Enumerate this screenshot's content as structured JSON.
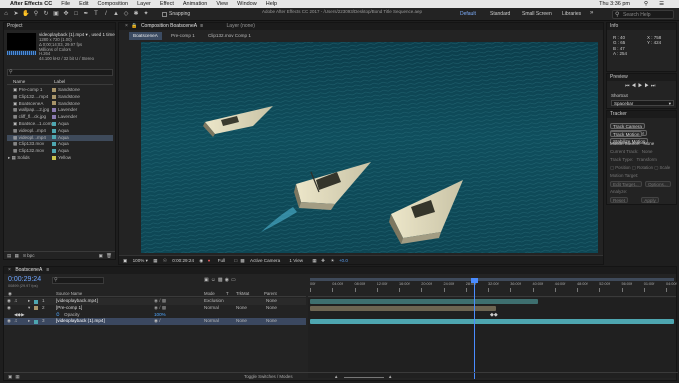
{
  "menubar": {
    "apple": "",
    "app_name": "After Effects CC",
    "menus": [
      "File",
      "Edit",
      "Composition",
      "Layer",
      "Effect",
      "Animation",
      "View",
      "Window",
      "Help"
    ],
    "clock": "Thu 3:36 pm"
  },
  "titlebar": {
    "title": "Adobe After Effects CC 2017 - /Users/223093/Desktop/Bond Title Sequence.aep"
  },
  "toolbar": {
    "snapping_label": "Snapping",
    "workspaces": [
      "Default",
      "Standard",
      "Small Screen",
      "Libraries"
    ],
    "search_placeholder": "Search Help"
  },
  "project": {
    "tab_label": "Project",
    "selected_name": "videoplayback (1).mp4 ▾ , used 1 time",
    "selected_info": [
      "1280 x 720 (1.00)",
      "Δ 0;00;14;03, 29.97 fps",
      "Millions of Colors",
      "H.264",
      "44.100 kHz / 32 bit U / Stereo"
    ],
    "search_placeholder": "",
    "col_name": "Name",
    "col_label": "Label",
    "items": [
      {
        "name": "Pre-comp 1",
        "label": "Sandstone",
        "color": "#a8956a"
      },
      {
        "name": "Clip132....mp4",
        "label": "Sandstone",
        "color": "#a8956a"
      },
      {
        "name": "BoatsceneA",
        "label": "Sandstone",
        "color": "#a8956a"
      },
      {
        "name": "wallpap....2.jpg",
        "label": "Lavender",
        "color": "#8a7ab0"
      },
      {
        "name": "cliff_fl...ck.jpg",
        "label": "Lavender",
        "color": "#8a7ab0"
      },
      {
        "name": "Boatsce...1.comp",
        "label": "Aqua",
        "color": "#4ea6b0"
      },
      {
        "name": "videopl...mp4",
        "label": "Aqua",
        "color": "#4ea6b0"
      },
      {
        "name": "videopl...mp4",
        "label": "Aqua",
        "color": "#4ea6b0"
      },
      {
        "name": "Clip133.mov",
        "label": "Aqua",
        "color": "#4ea6b0"
      },
      {
        "name": "Clip132.mov",
        "label": "Aqua",
        "color": "#4ea6b0"
      },
      {
        "name": "Solids",
        "label": "Yellow",
        "color": "#c8c24e"
      }
    ],
    "bpc": "8 bpc"
  },
  "composition": {
    "tabs": [
      "Composition BoatsceneA",
      "Layer (none)"
    ],
    "breadcrumbs": [
      "BoatsceneA",
      "Pre-comp 1",
      "Clip132.mov Comp 1"
    ],
    "zoom": "100%",
    "timecode": "0:00:29:24",
    "resolution": "Full",
    "camera": "Active Camera",
    "views": "1 View",
    "exposure": "+0.0"
  },
  "info": {
    "tab_label": "Info",
    "r": "R : 40",
    "g": "G : 65",
    "b": "B : 47",
    "a": "A : 254",
    "x": "X : 758",
    "y": "Y : 424"
  },
  "preview": {
    "tab_label": "Preview",
    "shortcut_label": "Shortcut",
    "shortcut_value": "Spacebar"
  },
  "tracker": {
    "tab_label": "Tracker",
    "buttons": [
      "Track Camera",
      "Warp Stabilizer",
      "Track Motion",
      "Stabilize Motion"
    ],
    "motion_source_label": "Motion Source:",
    "motion_source_value": "None",
    "current_track_label": "Current Track:",
    "current_track_value": "None",
    "track_type_label": "Track Type:",
    "track_type_value": "Transform",
    "checks": [
      "Position",
      "Rotation",
      "Scale"
    ],
    "motion_target": "Motion Target:",
    "edit_target": "Edit Target...",
    "options": "Options...",
    "analyze": "Analyze:",
    "reset": "Reset",
    "apply": "Apply"
  },
  "timeline": {
    "tab_label": "BoatsceneA",
    "timecode": "0:00:29:24",
    "frames": "00899 (29.97 fps)",
    "col_source": "Source Name",
    "col_mode": "Mode",
    "col_t": "T",
    "col_trkmat": "TrkMat",
    "col_parent": "Parent",
    "ruler": [
      "00f",
      "04:00f",
      "08:00f",
      "12:00f",
      "16:00f",
      "20:00f",
      "24:00f",
      "28:00f",
      "32:00f",
      "36:00f",
      "40:00f",
      "44:00f",
      "48:00f",
      "52:00f",
      "56:00f",
      "01:00f",
      "04:00f"
    ],
    "layers": [
      {
        "num": "1",
        "name": "[videoplayback.mp4]",
        "mode": "Exclusion",
        "trkmat": "",
        "parent": "None",
        "color": "#4ea6b0"
      },
      {
        "num": "2",
        "name": "[Pre-comp 1]",
        "mode": "Normal",
        "trkmat": "None",
        "parent": "None",
        "color": "#a8956a"
      },
      {
        "num": "",
        "name": "Opacity",
        "mode": "",
        "trkmat": "",
        "parent": "",
        "color": ""
      },
      {
        "num": "3",
        "name": "[videoplayback (1).mp4]",
        "mode": "Normal",
        "trkmat": "None",
        "parent": "None",
        "color": "#4ea6b0"
      }
    ],
    "opacity_value": "100%",
    "toggle_label": "Toggle Switches / Modes"
  }
}
